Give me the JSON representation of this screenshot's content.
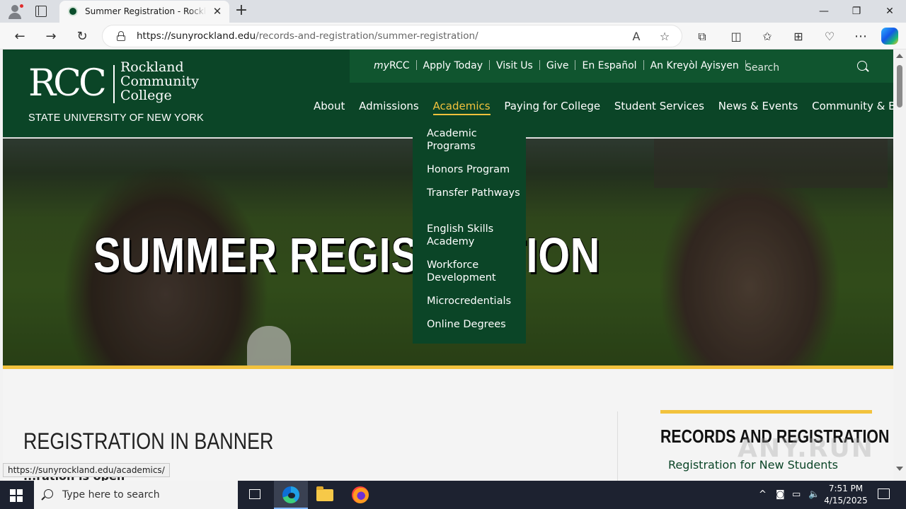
{
  "browser": {
    "tab_title": "Summer Registration - Rockland",
    "tab_close": "✕",
    "new_tab": "+",
    "url_host": "https://sunyrockland.edu",
    "url_path": "/records-and-registration/summer-registration/",
    "window": {
      "minimize": "—",
      "restore": "❐",
      "close": "✕"
    },
    "nav": {
      "back": "←",
      "forward": "→",
      "reload": "↻"
    },
    "read_aloud": "A",
    "favorite": "☆",
    "toolbar_icons": {
      "extensions": "⧉",
      "split": "◫",
      "favorites": "✩",
      "collections": "⊞",
      "performance": "♡",
      "more": "⋯"
    },
    "status_url": "https://sunyrockland.edu/academics/"
  },
  "site": {
    "logo": {
      "mark": "RCC",
      "name_lines": [
        "Rockland",
        "Community",
        "College"
      ],
      "subtitle": "STATE UNIVERSITY OF NEW YORK"
    },
    "utility_links": [
      {
        "prefix": "my",
        "label": "RCC"
      },
      {
        "label": "Apply Today"
      },
      {
        "label": "Visit Us"
      },
      {
        "label": "Give"
      },
      {
        "label": "En Español"
      },
      {
        "label": "An Kreyòl Ayisyen"
      }
    ],
    "search_placeholder": "Search",
    "main_nav": [
      "About",
      "Admissions",
      "Academics",
      "Paying for College",
      "Student Services",
      "News & Events",
      "Community & Business"
    ],
    "active_nav": "Academics",
    "dropdown": [
      "Academic Programs",
      "Honors Program",
      "Transfer Pathways",
      "English Skills Academy",
      "Workforce Development",
      "Microcredentials",
      "Online Degrees"
    ],
    "hero_title": "SUMMER REGISTRATION",
    "content": {
      "heading": "REGISTRATION IN BANNER",
      "partial_line": "...ration is open",
      "sidebar_title": "RECORDS AND REGISTRATION",
      "sidebar_link": "Registration for New Students"
    },
    "watermark": "ANY.RUN",
    "colors": {
      "brand_green": "#0b4527",
      "accent_gold": "#f2c23d"
    }
  },
  "taskbar": {
    "search_placeholder": "Type here to search",
    "time": "7:51 PM",
    "date": "4/15/2025",
    "tray": {
      "chevron": "^",
      "meet": "◙",
      "network": "▭",
      "volume": "🔈"
    }
  }
}
